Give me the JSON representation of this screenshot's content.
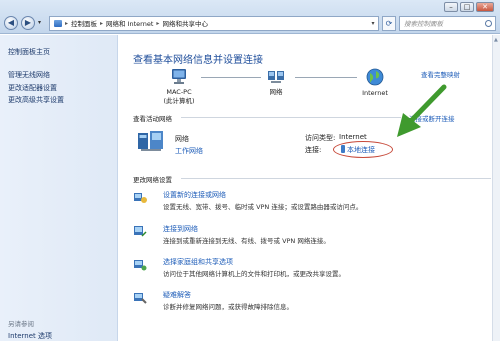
{
  "window": {
    "minimize": "–",
    "maximize": "□",
    "close": "✕"
  },
  "address": {
    "crumbs": [
      "控制面板",
      "网络和 Internet",
      "网络和共享中心"
    ],
    "search_placeholder": "搜索控制面板"
  },
  "sidebar": {
    "home": "控制面板主页",
    "links": [
      "管理无线网络",
      "更改适配器设置",
      "更改高级共享设置"
    ],
    "see_also": "另请参阅",
    "bottom_link": "Internet 选项"
  },
  "main": {
    "title": "查看基本网络信息并设置连接",
    "full_map": "查看完整映射",
    "nodes": [
      {
        "label": "MAC-PC",
        "sub": "(此计算机)"
      },
      {
        "label": "网络",
        "sub": ""
      },
      {
        "label": "Internet",
        "sub": ""
      }
    ],
    "active_networks_label": "查看活动网络",
    "connect_disconnect": "连接或断开连接",
    "network_name": "网络",
    "network_type": "工作网络",
    "access_type_label": "访问类型:",
    "access_type_value": "Internet",
    "connections_label": "连接:",
    "connection_value": "本地连接",
    "change_settings_label": "更改网络设置",
    "tasks": [
      {
        "title": "设置新的连接或网络",
        "desc": "设置无线、宽带、拨号、临时或 VPN 连接；或设置路由器或访问点。",
        "icon": "network-setup-icon"
      },
      {
        "title": "连接到网络",
        "desc": "连接到或重新连接到无线、有线、拨号或 VPN 网络连接。",
        "icon": "connect-network-icon"
      },
      {
        "title": "选择家庭组和共享选项",
        "desc": "访问位于其他网络计算机上的文件和打印机，或更改共享设置。",
        "icon": "homegroup-icon"
      },
      {
        "title": "疑难解答",
        "desc": "诊断并修复网络问题，或获得故障排除信息。",
        "icon": "troubleshoot-icon"
      }
    ]
  },
  "colors": {
    "link": "#1d5cb8",
    "title": "#1f4e9b",
    "arrow": "#3f9a2e",
    "highlight": "#c74a3a"
  }
}
